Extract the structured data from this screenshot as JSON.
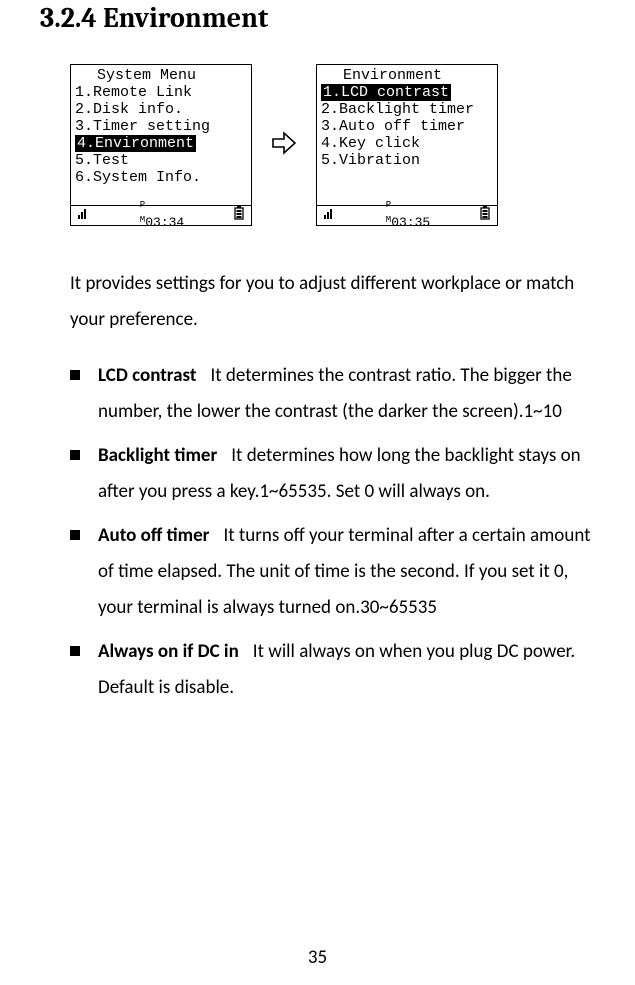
{
  "heading": "3.2.4   Environment",
  "screen1": {
    "title": "System Menu",
    "items": [
      "1.Remote Link",
      "2.Disk info.",
      "3.Timer setting",
      "4.Environment",
      "5.Test",
      "6.System Info."
    ],
    "highlight_index": 3,
    "status_time": "03:34"
  },
  "screen2": {
    "title": "Environment",
    "items": [
      "1.LCD contrast",
      "2.Backlight timer",
      "3.Auto off timer",
      "4.Key click",
      "5.Vibration"
    ],
    "highlight_index": 0,
    "status_time": "03:35"
  },
  "intro": "It provides settings for you to adjust different workplace or match your preference.",
  "bullets": [
    {
      "term": "LCD contrast",
      "desc": "It determines the contrast ratio. The bigger the number, the lower the contrast (the darker the screen).1~10"
    },
    {
      "term": "Backlight timer",
      "desc": "It determines how long the backlight stays on after you press a key.1~65535. Set 0 will always on."
    },
    {
      "term": "Auto off timer",
      "desc": "It turns off your terminal after a certain amount of time elapsed. The unit of time is the second. If you set it 0, your terminal is always turned on.30~65535"
    },
    {
      "term": "Always on if DC in",
      "desc": "It will always on when you plug DC power. Default is disable."
    }
  ],
  "page_number": "35"
}
